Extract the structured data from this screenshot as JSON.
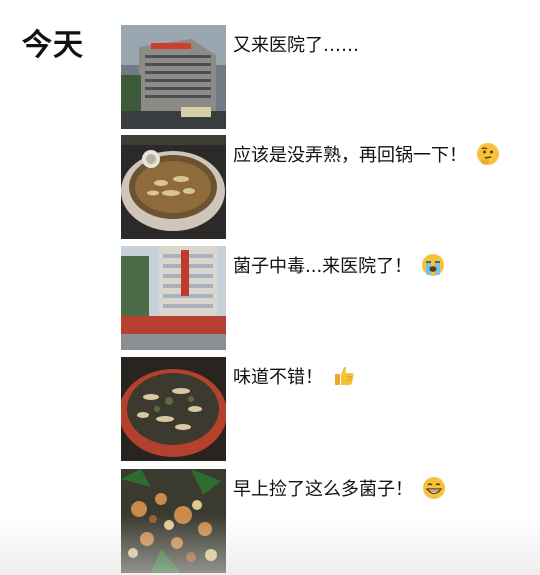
{
  "day_label": "今天",
  "posts": [
    {
      "caption": "又来医院了……",
      "icon": "none",
      "thumb": "hospital-building-photo"
    },
    {
      "caption": "应该是没弄熟，再回锅一下！",
      "icon": "thinking-face-emoji",
      "thumb": "mushroom-pot-photo"
    },
    {
      "caption": "菌子中毒...来医院了！",
      "icon": "crying-face-emoji",
      "thumb": "hospital-entrance-photo"
    },
    {
      "caption": "味道不错！",
      "icon": "thumbs-up-emoji",
      "thumb": "mushroom-hotpot-photo"
    },
    {
      "caption": "早上捡了这么多菌子！",
      "icon": "grinning-face-emoji",
      "thumb": "foraged-mushrooms-photo"
    }
  ]
}
